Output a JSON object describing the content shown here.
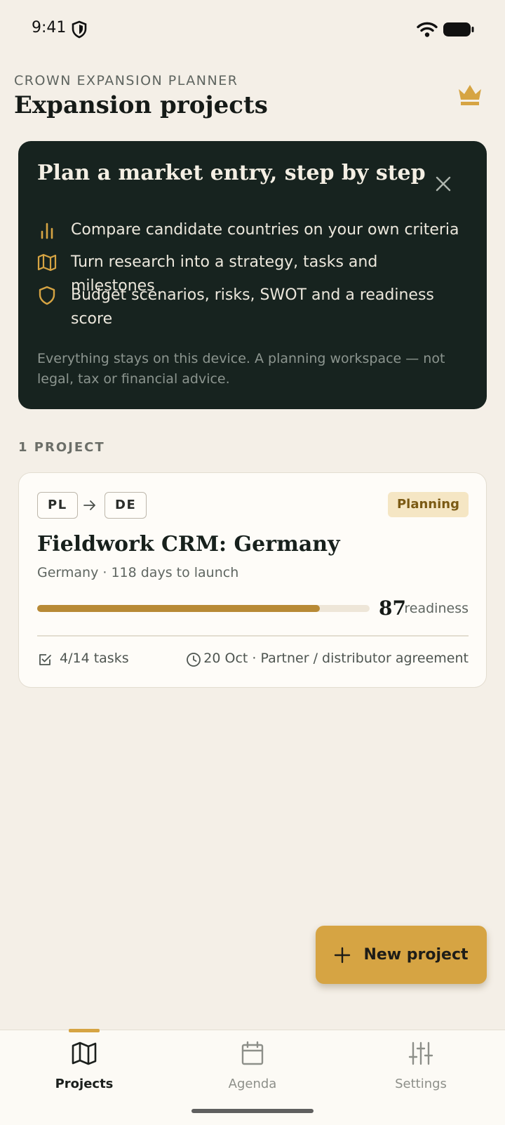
{
  "status_bar": {
    "time": "9:41"
  },
  "header": {
    "eyebrow": "CROWN EXPANSION PLANNER",
    "title": "Expansion projects"
  },
  "intro": {
    "title": "Plan a market entry, step by step",
    "features": [
      {
        "icon": "bar-chart-icon",
        "text": "Compare candidate countries on your own criteria"
      },
      {
        "icon": "map-icon",
        "text": "Turn research into a strategy, tasks and milestones"
      },
      {
        "icon": "shield-icon",
        "text": "Budget scenarios, risks, SWOT and a readiness score"
      }
    ],
    "note": "Everything stays on this device. A planning workspace — not legal, tax or financial advice."
  },
  "projects_section": {
    "count_label": "1 PROJECT"
  },
  "project": {
    "from_code": "PL",
    "to_code": "DE",
    "status": "Planning",
    "name": "Fieldwork CRM: Germany",
    "subtitle": "Germany · 118 days to launch",
    "readiness_score": "87",
    "readiness_label": "readiness",
    "readiness_fraction": 0.85,
    "tasks": "4/14 tasks",
    "next_milestone": "20 Oct · Partner / distributor agreement"
  },
  "fab": {
    "label": "New project"
  },
  "nav": {
    "items": [
      {
        "label": "Projects",
        "icon": "map-icon"
      },
      {
        "label": "Agenda",
        "icon": "calendar-icon"
      },
      {
        "label": "Settings",
        "icon": "sliders-icon"
      }
    ],
    "active": "Projects"
  },
  "colors": {
    "accent": "#d6a443",
    "intro_bg": "#17231f",
    "page_bg": "#f4efe7",
    "progress": "#b88a36",
    "badge_bg": "#f5e6c4"
  }
}
